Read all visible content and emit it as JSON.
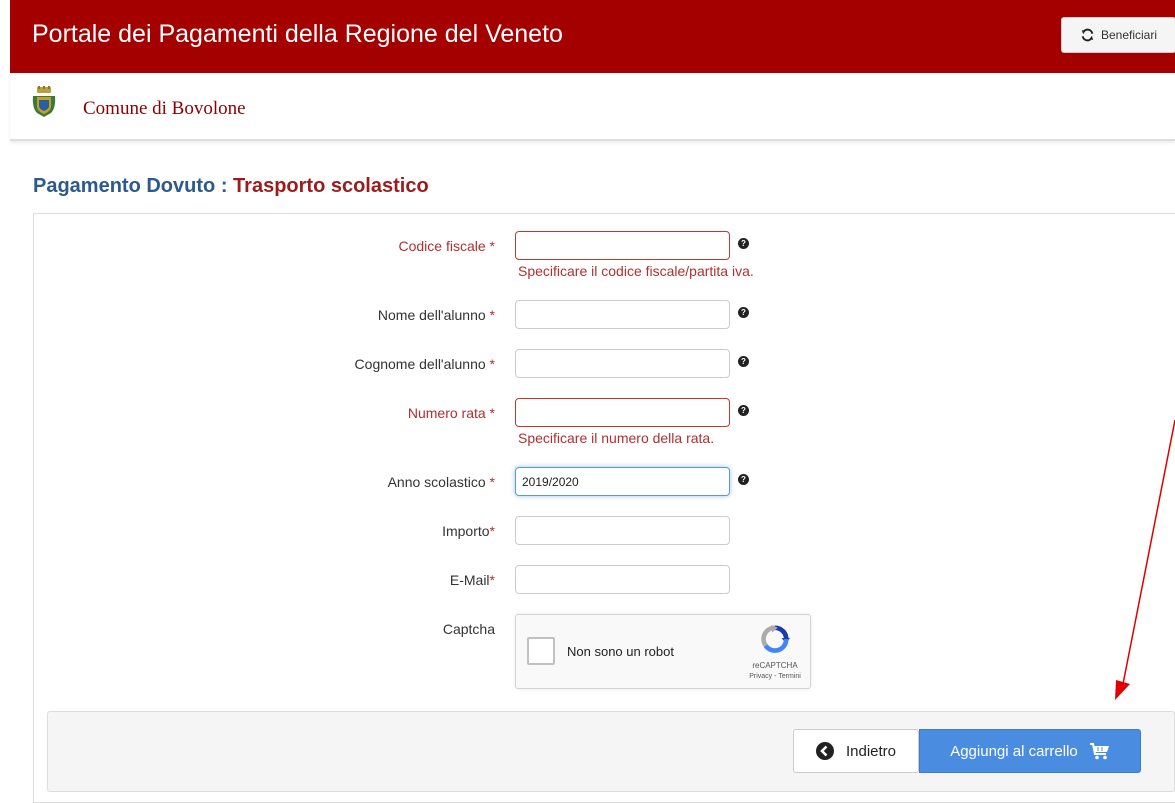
{
  "header": {
    "portal_title": "Portale dei Pagamenti della Regione del Veneto",
    "beneficiari_label": "Beneficiari",
    "beneficiari_icon": "refresh-icon"
  },
  "entity": {
    "name": "Comune di Bovolone",
    "crest_icon": "municipal-crest-icon"
  },
  "page": {
    "title_prefix": "Pagamento Dovuto",
    "title_separator": ":",
    "title_service": "Trasporto scolastico"
  },
  "form": {
    "required_marker": "*",
    "fields": [
      {
        "label": "Codice fiscale",
        "value": "",
        "error": "Specificare il codice fiscale/partita iva.",
        "has_help": true
      },
      {
        "label": "Nome dell'alunno",
        "value": "",
        "error": "",
        "has_help": true
      },
      {
        "label": "Cognome dell'alunno",
        "value": "",
        "error": "",
        "has_help": true
      },
      {
        "label": "Numero rata",
        "value": "",
        "error": "Specificare il numero della rata.",
        "has_help": true
      },
      {
        "label": "Anno scolastico",
        "value": "2019/2020",
        "error": "",
        "has_help": true
      },
      {
        "label": "Importo",
        "value": "",
        "error": "",
        "has_help": false
      },
      {
        "label": "E-Mail",
        "value": "",
        "error": "",
        "has_help": false
      }
    ],
    "captcha": {
      "label": "Captcha",
      "checkbox_text": "Non sono un robot",
      "brand": "reCAPTCHA",
      "links": "Privacy - Termini"
    }
  },
  "actions": {
    "back_label": "Indietro",
    "back_icon": "chevron-left-circle-icon",
    "add_label": "Aggiungi al carrello",
    "add_icon": "cart-icon"
  },
  "colors": {
    "header_bg": "#a50000",
    "title_blue": "#2c5a8c",
    "title_red": "#9b1c1c",
    "error_red": "#b03030",
    "primary_button": "#4a8de0",
    "annotation_arrow": "#e00000"
  }
}
